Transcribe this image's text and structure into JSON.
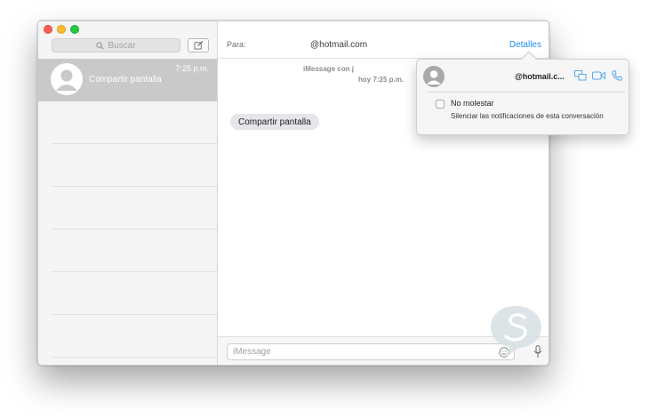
{
  "sidebar": {
    "search_placeholder": "Buscar",
    "conversation": {
      "name": "Compartir pantalla",
      "time": "7:25 p.m."
    }
  },
  "header": {
    "to_label": "Para:",
    "to_value": "@hotmail.com",
    "details_label": "Detalles"
  },
  "thread": {
    "info_line1": "iMessage con j",
    "info_line2": "hoy 7:25 p.m.",
    "messages": [
      {
        "text": "Compartir pantalla"
      }
    ]
  },
  "composer": {
    "placeholder": "iMessage"
  },
  "details_popover": {
    "email": "@hotmail.c...",
    "do_not_disturb_label": "No molestar",
    "do_not_disturb_desc": "Silenciar las notificaciones de esta conversación",
    "do_not_disturb_checked": false
  },
  "colors": {
    "accent": "#1d8ef0",
    "selected_row": "#c9c9c9"
  },
  "icons": {
    "search": "search-icon",
    "compose": "compose-icon",
    "screen_share": "screen-share-icon",
    "video": "video-call-icon",
    "phone": "phone-icon",
    "emoji": "emoji-icon",
    "mic": "microphone-icon"
  }
}
